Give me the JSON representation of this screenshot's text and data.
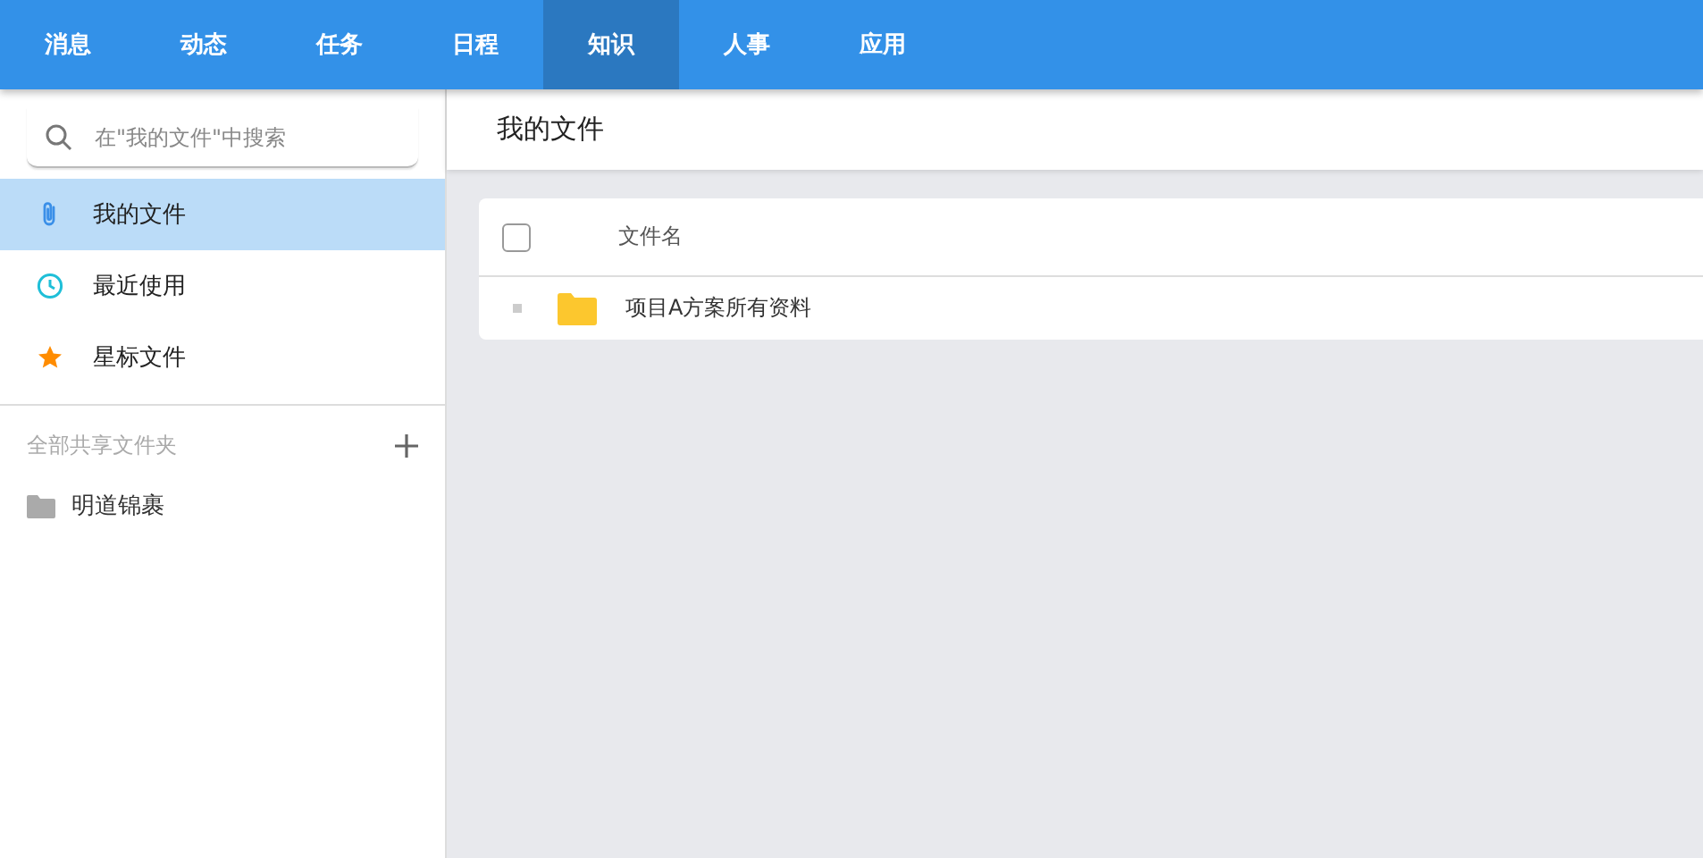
{
  "nav": {
    "tabs": [
      {
        "label": "消息",
        "selected": false
      },
      {
        "label": "动态",
        "selected": false
      },
      {
        "label": "任务",
        "selected": false
      },
      {
        "label": "日程",
        "selected": false
      },
      {
        "label": "知识",
        "selected": true
      },
      {
        "label": "人事",
        "selected": false
      },
      {
        "label": "应用",
        "selected": false
      }
    ]
  },
  "sidebar": {
    "search": {
      "placeholder": "在\"我的文件\"中搜索"
    },
    "items": [
      {
        "label": "我的文件",
        "kind": "clip",
        "selected": true
      },
      {
        "label": "最近使用",
        "kind": "clock",
        "selected": false
      },
      {
        "label": "星标文件",
        "kind": "star",
        "selected": false
      }
    ],
    "shared_section": {
      "title": "全部共享文件夹",
      "folders": [
        {
          "label": "明道锦裹"
        }
      ]
    }
  },
  "main": {
    "title": "我的文件",
    "table": {
      "select_all_checked": false,
      "columns": [
        "文件名"
      ],
      "rows": [
        {
          "name": "项目A方案所有资料",
          "kind": "folder"
        }
      ]
    }
  }
}
